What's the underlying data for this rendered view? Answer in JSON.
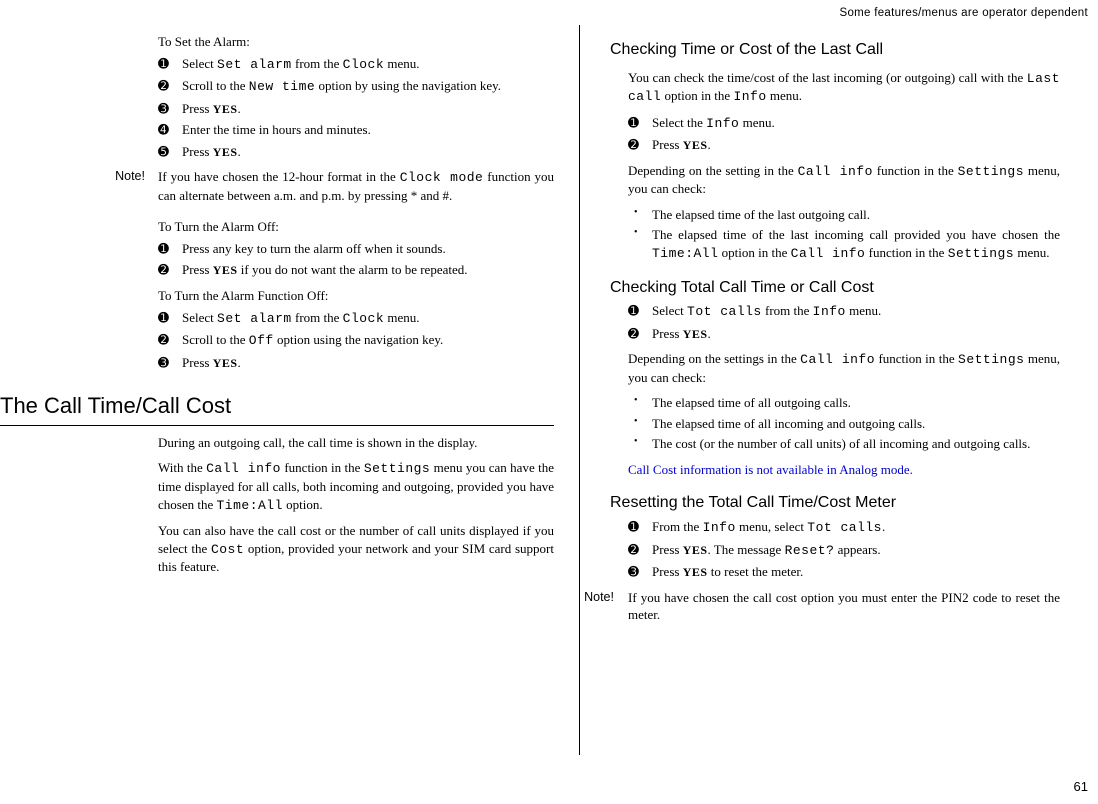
{
  "topNote": "Some features/menus are operator dependent",
  "pageNum": "61",
  "left": {
    "setAlarmTitle": "To Set the Alarm:",
    "setAlarmStep1a": "Select ",
    "setAlarmStep1b": "Set alarm",
    "setAlarmStep1c": " from the ",
    "setAlarmStep1d": "Clock",
    "setAlarmStep1e": " menu.",
    "setAlarmStep2a": "Scroll to the ",
    "setAlarmStep2b": "New time",
    "setAlarmStep2c": " option by using the navigation key.",
    "setAlarmStep3a": "Press ",
    "setAlarmStep3b": "YES",
    "setAlarmStep3c": ".",
    "setAlarmStep4": "Enter the time in hours and minutes.",
    "setAlarmStep5a": "Press ",
    "setAlarmStep5b": "YES",
    "setAlarmStep5c": ".",
    "noteLabel": "Note!",
    "noteTextA": "If you have chosen the 12-hour format in the ",
    "noteTextB": "Clock mode",
    "noteTextC": " function you can alternate between a.m. and p.m. by pressing * and #.",
    "alarmOffTitle": "To Turn the Alarm Off:",
    "alarmOff1": "Press any key to turn the alarm off when it sounds.",
    "alarmOff2a": "Press ",
    "alarmOff2b": "YES",
    "alarmOff2c": " if you do not want the alarm to be repeated.",
    "alarmFuncOffTitle": "To Turn the Alarm Function Off:",
    "afo1a": "Select ",
    "afo1b": "Set alarm",
    "afo1c": " from the ",
    "afo1d": "Clock",
    "afo1e": " menu.",
    "afo2a": "Scroll to the ",
    "afo2b": "Off",
    "afo2c": " option using the navigation key.",
    "afo3a": "Press ",
    "afo3b": "YES",
    "afo3c": ".",
    "h2CallTime": "The Call Time/Call Cost",
    "paraDuring": "During an outgoing call, the call time is shown in the display.",
    "paraWithA": "With the ",
    "paraWithB": "Call info",
    "paraWithC": " function in the ",
    "paraWithD": "Settings",
    "paraWithE": " menu you can have the time displayed for all calls, both incoming and outgoing, provided you have chosen the ",
    "paraWithF": "Time:All",
    "paraWithG": " option.",
    "para2A": "You can also have the call cost or the number of call units displayed if you select the ",
    "para2B": "Cost",
    "para2C": " option, provided your network and your SIM card support this feature."
  },
  "right": {
    "h3CheckLast": "Checking Time or Cost of the Last Call",
    "lastParaA": "You can check the time/cost of the last incoming (or outgoing) call with the ",
    "lastParaB": "Last call",
    "lastParaC": " option in the ",
    "lastParaD": "Info",
    "lastParaE": " menu.",
    "last1a": "Select the ",
    "last1b": "Info",
    "last1c": " menu.",
    "last2a": "Press ",
    "last2b": "YES",
    "last2c": ".",
    "depA": "Depending on the setting in the ",
    "depB": "Call info",
    "depC": " function in the ",
    "depD": "Settings",
    "depE": " menu, you can check:",
    "bullet1": "The elapsed time of the last outgoing call.",
    "bullet2a": "The elapsed time of the last incoming call provided you have chosen the ",
    "bullet2b": "Time:All",
    "bullet2c": " option in the ",
    "bullet2d": "Call info",
    "bullet2e": " function in the ",
    "bullet2f": "Settings",
    "bullet2g": " menu.",
    "h3Total": "Checking Total Call Time or Call Cost",
    "tot1a": "Select ",
    "tot1b": "Tot calls",
    "tot1c": " from the ",
    "tot1d": "Info",
    "tot1e": " menu.",
    "tot2a": "Press ",
    "tot2b": "YES",
    "tot2c": ".",
    "dep2A": "Depending on the settings in the ",
    "dep2B": "Call info",
    "dep2C": " function in the ",
    "dep2D": "Settings",
    "dep2E": " menu, you can check:",
    "b21": "The elapsed time of all outgoing calls.",
    "b22": "The elapsed time of all incoming and outgoing calls.",
    "b23": "The cost (or the number of call units) of all incoming and outgoing calls.",
    "blueNote": "Call Cost information is not available in Analog mode.",
    "h3Reset": "Resetting the Total Call Time/Cost Meter",
    "r1a": "From the ",
    "r1b": "Info",
    "r1c": " menu, select ",
    "r1d": "Tot calls",
    "r1e": ".",
    "r2a": "Press ",
    "r2b": "YES",
    "r2c": ". The message ",
    "r2d": "Reset?",
    "r2e": " appears.",
    "r3a": "Press ",
    "r3b": "YES",
    "r3c": " to reset the meter.",
    "noteLabel": "Note!",
    "note2": "If you have chosen the call cost option you must enter the PIN2 code to reset the meter."
  }
}
